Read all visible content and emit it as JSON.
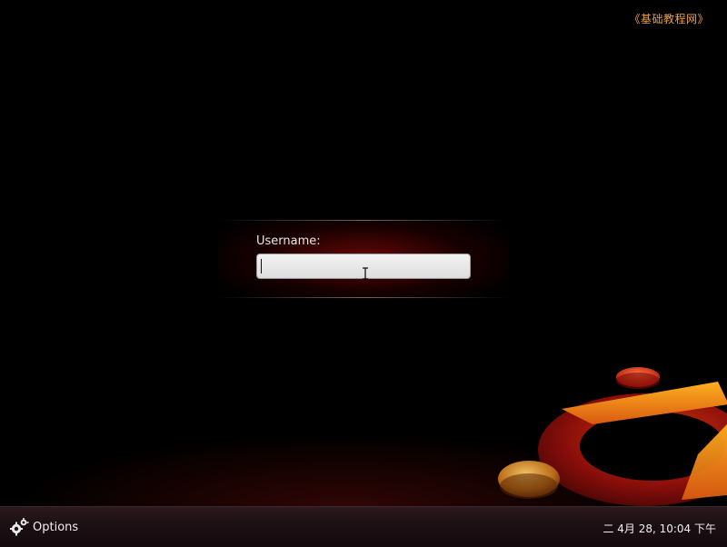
{
  "watermark": "《基础教程网》",
  "login": {
    "username_label": "Username:",
    "username_value": ""
  },
  "bottom_bar": {
    "options_label": "Options",
    "clock": "二  4月 28, 10:04 下午"
  },
  "icons": {
    "options": "gear-icon",
    "logo": "ubuntu-logo",
    "cursor": "text-cursor-icon"
  },
  "colors": {
    "background": "#000000",
    "accent_orange": "#f07a20",
    "panel_red": "#78080a",
    "bar": "#1c1014",
    "watermark": "#f0a040"
  }
}
